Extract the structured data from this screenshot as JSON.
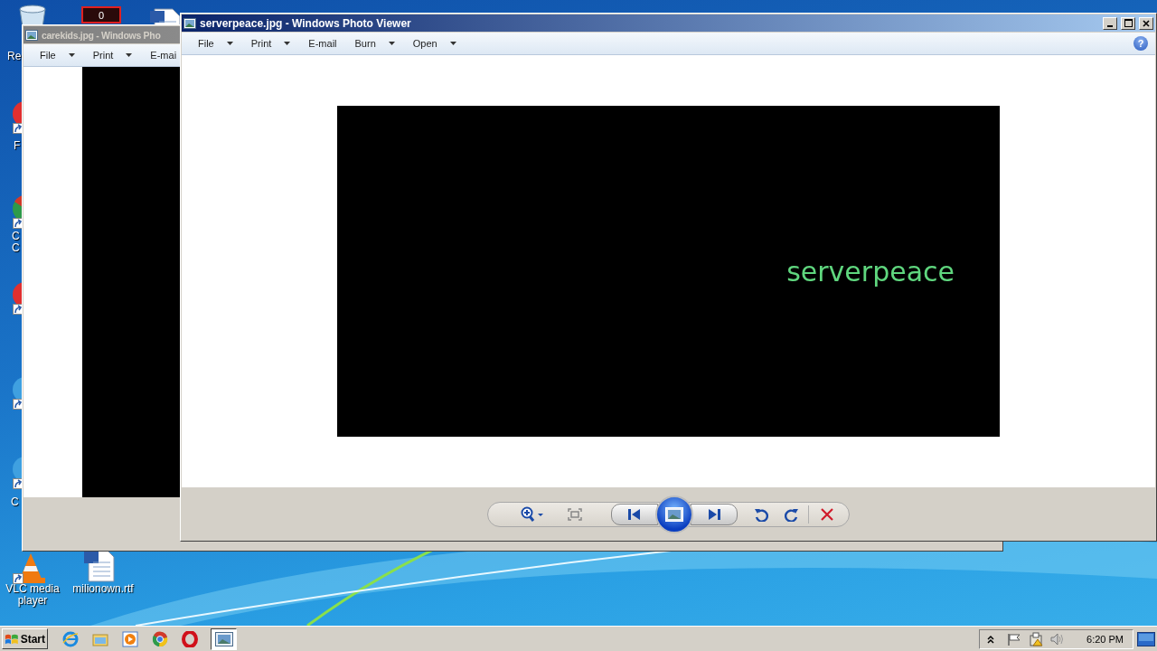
{
  "desktop_icons": [
    {
      "kind": "recycle-bin",
      "label": "Re"
    },
    {
      "kind": "counter",
      "badge": "0"
    },
    {
      "kind": "document"
    },
    {
      "kind": "red-app",
      "label": "F"
    },
    {
      "kind": "green-app",
      "label": "C\nC"
    },
    {
      "kind": "red-app"
    },
    {
      "kind": "blue-app"
    },
    {
      "kind": "blue-app",
      "label": "C"
    },
    {
      "kind": "cone",
      "label": "VLC media player"
    },
    {
      "kind": "document",
      "label": "milionown.rtf"
    }
  ],
  "windows": [
    {
      "title": "carekids.jpg - Windows Pho",
      "active": false,
      "menu": [
        {
          "label": "File",
          "dropdown": true
        },
        {
          "label": "Print",
          "dropdown": true
        },
        {
          "label": "E-mai",
          "dropdown": false
        }
      ]
    },
    {
      "title": "serverpeace.jpg - Windows Photo Viewer",
      "active": true,
      "menu": [
        {
          "label": "File",
          "dropdown": true
        },
        {
          "label": "Print",
          "dropdown": true
        },
        {
          "label": "E-mail",
          "dropdown": false
        },
        {
          "label": "Burn",
          "dropdown": true
        },
        {
          "label": "Open",
          "dropdown": true
        }
      ],
      "help": "?",
      "image_text": "serverpeace"
    }
  ],
  "taskbar": {
    "start": "Start",
    "quick_launch": [
      {
        "kind": "browser-e"
      },
      {
        "kind": "folder"
      },
      {
        "kind": "player"
      },
      {
        "kind": "chrome"
      },
      {
        "kind": "opera"
      }
    ],
    "tasks": [
      {
        "kind": "photo-viewer",
        "selected": true
      }
    ],
    "clock": "6:20 PM"
  }
}
